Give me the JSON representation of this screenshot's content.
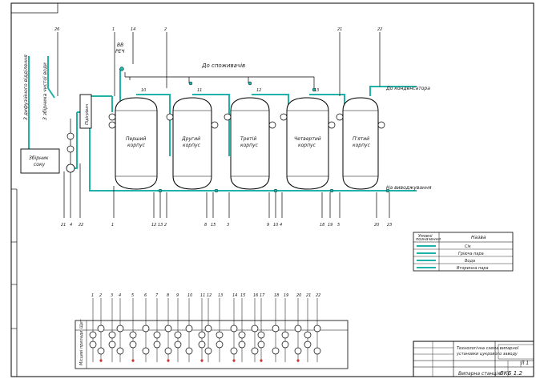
{
  "labels": {
    "to_consumers": "До споживачів",
    "to_condenser": "До конденсатора",
    "to_drainage": "На виводжування",
    "upper_gas": "ВВ\nРЕЧ",
    "recv_tank": "Збірник\nсоку",
    "heater": "Підігрівач",
    "in_left_1": "З дифузійного відділення",
    "in_left_2": "З збірника чистої води",
    "vessels": [
      "Перший\nкорпус",
      "Другий\nкорпус",
      "Третій\nкорпус",
      "Четвертий\nкорпус",
      "П'ятий\nкорпус"
    ]
  },
  "legend": {
    "header_left": "Умовні\nпозначення",
    "header_right": "Назва",
    "rows": [
      "Сік",
      "Гріюча пара",
      "Вода",
      "Вторинна пара"
    ]
  },
  "title_block": {
    "title": "Випарна станція",
    "code": "ВКБ 1.2",
    "sheet": "Л 1 ",
    "desc_1": "Технологічна схема випарної",
    "desc_2": "установки цукрового заводу"
  },
  "colors": {
    "line": "#000000",
    "juice": "#1fb2a8",
    "red": "#d63333"
  }
}
